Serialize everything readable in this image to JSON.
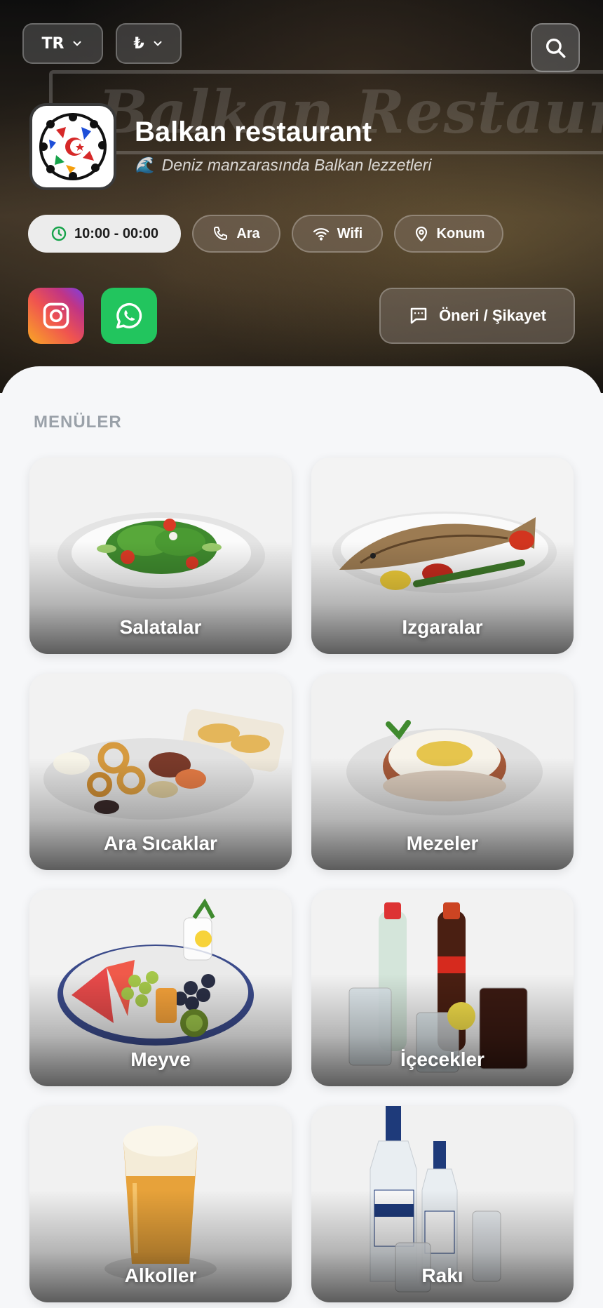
{
  "header": {
    "language": "TR",
    "currency": "₺",
    "restaurant_name": "Balkan restaurant",
    "sign_text": "Balkan Restaurant",
    "tagline_emoji": "🌊",
    "tagline": "Deniz manzarasında Balkan lezzetleri"
  },
  "info_chips": {
    "hours": "10:00 - 00:00",
    "call": "Ara",
    "wifi": "Wifi",
    "location": "Konum"
  },
  "feedback_label": "Öneri / Şikayet",
  "section": {
    "title": "MENÜLER"
  },
  "menus": [
    {
      "label": "Salatalar"
    },
    {
      "label": "Izgaralar"
    },
    {
      "label": "Ara Sıcaklar"
    },
    {
      "label": "Mezeler"
    },
    {
      "label": "Meyve"
    },
    {
      "label": "İçecekler"
    },
    {
      "label": "Alkoller"
    },
    {
      "label": "Rakı"
    }
  ],
  "icons": {
    "chevron": "chevron-down-icon",
    "search": "search-icon",
    "clock": "clock-icon",
    "phone": "phone-icon",
    "wifi": "wifi-icon",
    "location": "map-pin-icon",
    "instagram": "instagram-icon",
    "whatsapp": "whatsapp-icon",
    "feedback": "chat-bubble-icon"
  },
  "colors": {
    "accent_green": "#22c55e",
    "hours_chip_bg": "#ececec",
    "clock_icon": "#16a34a",
    "section_title": "#9aa1a9"
  }
}
